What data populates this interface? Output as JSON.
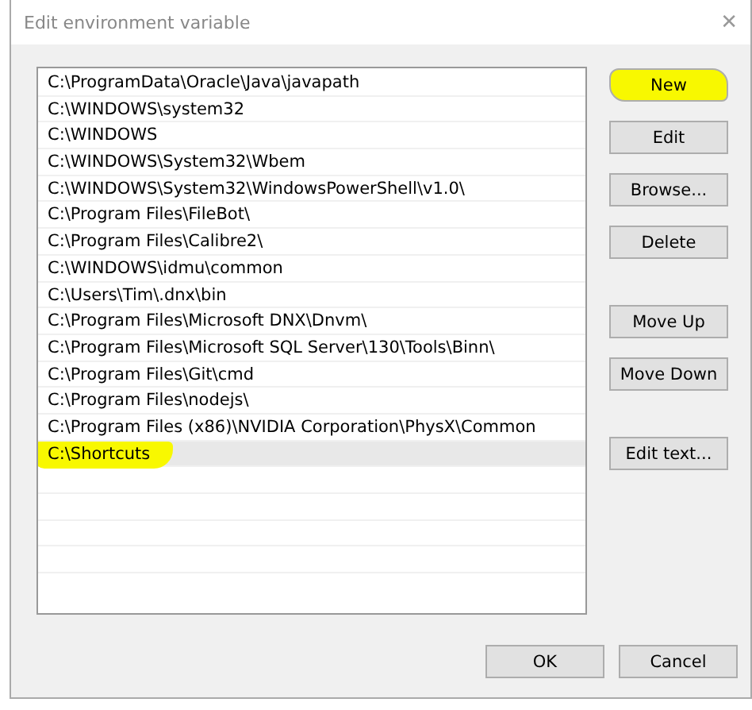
{
  "window": {
    "title": "Edit environment variable",
    "close": "✕"
  },
  "entries": [
    {
      "text": "C:\\ProgramData\\Oracle\\Java\\javapath",
      "selected": false,
      "highlighted": false
    },
    {
      "text": "C:\\WINDOWS\\system32",
      "selected": false,
      "highlighted": false
    },
    {
      "text": "C:\\WINDOWS",
      "selected": false,
      "highlighted": false
    },
    {
      "text": "C:\\WINDOWS\\System32\\Wbem",
      "selected": false,
      "highlighted": false
    },
    {
      "text": "C:\\WINDOWS\\System32\\WindowsPowerShell\\v1.0\\",
      "selected": false,
      "highlighted": false
    },
    {
      "text": "C:\\Program Files\\FileBot\\",
      "selected": false,
      "highlighted": false
    },
    {
      "text": "C:\\Program Files\\Calibre2\\",
      "selected": false,
      "highlighted": false
    },
    {
      "text": "C:\\WINDOWS\\idmu\\common",
      "selected": false,
      "highlighted": false
    },
    {
      "text": "C:\\Users\\Tim\\.dnx\\bin",
      "selected": false,
      "highlighted": false
    },
    {
      "text": "C:\\Program Files\\Microsoft DNX\\Dnvm\\",
      "selected": false,
      "highlighted": false
    },
    {
      "text": "C:\\Program Files\\Microsoft SQL Server\\130\\Tools\\Binn\\",
      "selected": false,
      "highlighted": false
    },
    {
      "text": "C:\\Program Files\\Git\\cmd",
      "selected": false,
      "highlighted": false
    },
    {
      "text": "C:\\Program Files\\nodejs\\",
      "selected": false,
      "highlighted": false
    },
    {
      "text": "C:\\Program Files (x86)\\NVIDIA Corporation\\PhysX\\Common",
      "selected": false,
      "highlighted": false
    },
    {
      "text": "C:\\Shortcuts",
      "selected": true,
      "highlighted": true
    }
  ],
  "side_button_groups": [
    [
      {
        "label": "New",
        "highlighted": true
      },
      {
        "label": "Edit",
        "highlighted": false
      },
      {
        "label": "Browse...",
        "highlighted": false
      },
      {
        "label": "Delete",
        "highlighted": false
      }
    ],
    [
      {
        "label": "Move Up",
        "highlighted": false
      },
      {
        "label": "Move Down",
        "highlighted": false
      }
    ],
    [
      {
        "label": "Edit text...",
        "highlighted": false
      }
    ]
  ],
  "footer_buttons": [
    "OK",
    "Cancel"
  ]
}
